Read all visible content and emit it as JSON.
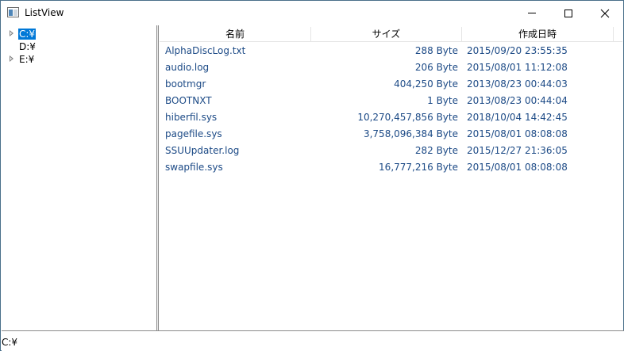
{
  "window": {
    "title": "ListView",
    "icon": "app-window-icon",
    "controls": {
      "minimize": "minimize-icon",
      "maximize": "maximize-icon",
      "close": "close-icon"
    }
  },
  "tree": {
    "items": [
      {
        "label": "C:¥",
        "selected": true,
        "expander": "expand-arrow-icon"
      },
      {
        "label": "D:¥",
        "selected": false
      },
      {
        "label": "E:¥",
        "selected": false,
        "expander": "expand-arrow-icon"
      }
    ]
  },
  "list": {
    "columns": {
      "name": "名前",
      "size": "サイズ",
      "date": "作成日時"
    },
    "rows": [
      {
        "name": "AlphaDiscLog.txt",
        "size": "288 Byte",
        "date": "2015/09/20 23:55:35"
      },
      {
        "name": "audio.log",
        "size": "206 Byte",
        "date": "2015/08/01 11:12:08"
      },
      {
        "name": "bootmgr",
        "size": "404,250 Byte",
        "date": "2013/08/23 00:44:03"
      },
      {
        "name": "BOOTNXT",
        "size": "1 Byte",
        "date": "2013/08/23 00:44:04"
      },
      {
        "name": "hiberfil.sys",
        "size": "10,270,457,856 Byte",
        "date": "2018/10/04 14:42:45"
      },
      {
        "name": "pagefile.sys",
        "size": "3,758,096,384 Byte",
        "date": "2015/08/01 08:08:08"
      },
      {
        "name": "SSUUpdater.log",
        "size": "282 Byte",
        "date": "2015/12/27 21:36:05"
      },
      {
        "name": "swapfile.sys",
        "size": "16,777,216 Byte",
        "date": "2015/08/01 08:08:08"
      }
    ]
  },
  "status": {
    "text": "C:¥"
  },
  "colors": {
    "selection": "#0078d7",
    "row_text": "#1c4a86"
  }
}
